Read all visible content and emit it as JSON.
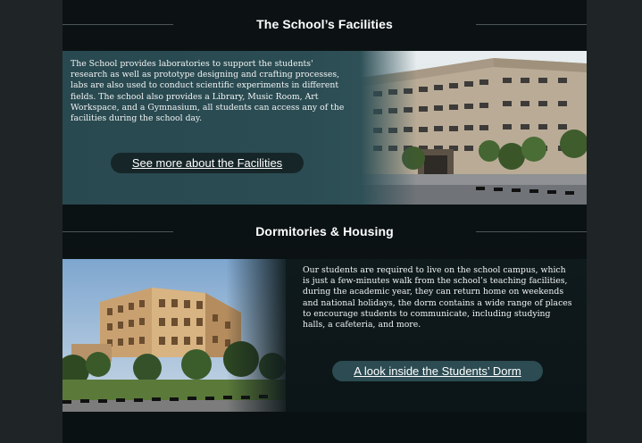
{
  "facilities": {
    "heading": "The School’s Facilities",
    "body": "The School provides laboratories to support the students' research as well as prototype designing and crafting processes, labs are also used to conduct scientific experiments in different fields. The school also provides a Library, Music Room, Art Workspace, and a Gymnasium, all students can access any of the facilities during the school day.",
    "link_label": "See more about the Facilities"
  },
  "dormitories": {
    "heading": "Dormitories & Housing",
    "body": "Our students are required to live on the school campus, which is just a few-minutes walk from the school’s teaching facilities, during the academic year, they can return home on weekends and national holidays, the dorm contains a wide range of places to encourage students to communicate, including studying halls, a cafeteria, and more.",
    "link_label": "A look inside the Students’ Dorm"
  }
}
